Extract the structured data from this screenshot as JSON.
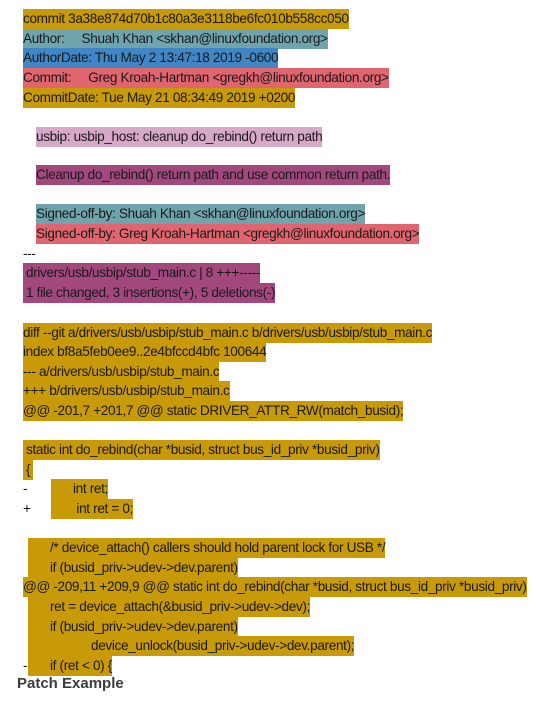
{
  "patch": {
    "header": {
      "commit": "commit 3a38e874d70b1c80a3e3118be6fc010b558cc050",
      "author": "Author:     Shuah Khan <skhan@linuxfoundation.org>",
      "author_date": "AuthorDate: Thu May 2 13:47:18 2019 -0600",
      "committer": "Commit:     Greg Kroah-Hartman <gregkh@linuxfoundation.org>",
      "commit_date": "CommitDate: Tue May 21 08:34:49 2019 +0200"
    },
    "message": {
      "subject": "usbip: usbip_host: cleanup do_rebind() return path",
      "body": "Cleanup do_rebind() return path and use common return path.",
      "signoff_1": "Signed-off-by: Shuah Khan <skhan@linuxfoundation.org>",
      "signoff_2": "Signed-off-by: Greg Kroah-Hartman <gregkh@linuxfoundation.org>"
    },
    "stat": {
      "separator": "---",
      "file_line": "drivers/usb/usbip/stub_main.c | 8 +++-----",
      "summary": "1 file changed, 3 insertions(+), 5 deletions(-)"
    },
    "diff": {
      "diff_git": "diff --git a/drivers/usb/usbip/stub_main.c b/drivers/usb/usbip/stub_main.c",
      "index": "index bf8a5feb0ee9..2e4bfccd4bfc 100644",
      "old_file": "--- a/drivers/usb/usbip/stub_main.c",
      "new_file": "+++ b/drivers/usb/usbip/stub_main.c",
      "hunk_1": "@@ -201,7 +201,7 @@ static DRIVER_ATTR_RW(match_busid);",
      "hunk_2": "@@ -209,11 +209,9 @@ static int do_rebind(char *busid, struct bus_id_priv *busid_priv)"
    },
    "code": {
      "func_sig": "static int do_rebind(char *busid, struct bus_id_priv *busid_priv)",
      "brace": "{",
      "del_marker": "-",
      "del_ret": "int ret;",
      "add_marker": "+",
      "add_ret": " int ret = 0;",
      "comment": "/* device_attach() callers should hold parent lock for USB */",
      "if_parent_1": "if (busid_priv->udev->dev.parent)",
      "ret_attach": "ret = device_attach(&busid_priv->udev->dev);",
      "if_parent_2": "if (busid_priv->udev->dev.parent)",
      "unlock": "device_unlock(busid_priv->udev->dev.parent);",
      "del_marker_2": "-",
      "if_ret": "if (ret < 0) {"
    }
  },
  "caption": "Patch Example"
}
